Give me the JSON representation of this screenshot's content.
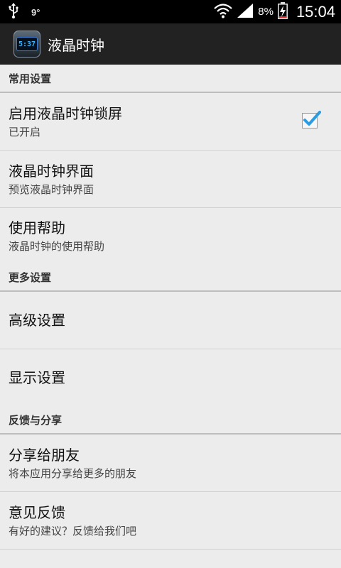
{
  "status_bar": {
    "degree": "9°",
    "battery": "8%",
    "time": "15:04"
  },
  "action_bar": {
    "icon_time": "5:37",
    "title": "液晶时钟"
  },
  "sections": [
    {
      "header": "常用设置",
      "items": [
        {
          "title": "启用液晶时钟锁屏",
          "subtitle": "已开启",
          "checked": true
        },
        {
          "title": "液晶时钟界面",
          "subtitle": "预览液晶时钟界面"
        },
        {
          "title": "使用帮助",
          "subtitle": "液晶时钟的使用帮助"
        }
      ]
    },
    {
      "header": "更多设置",
      "items": [
        {
          "title": "高级设置"
        },
        {
          "title": "显示设置"
        }
      ]
    },
    {
      "header": "反馈与分享",
      "items": [
        {
          "title": "分享给朋友",
          "subtitle": "将本应用分享给更多的朋友"
        },
        {
          "title": "意见反馈",
          "subtitle": "有好的建议？反馈给我们吧"
        }
      ]
    }
  ]
}
